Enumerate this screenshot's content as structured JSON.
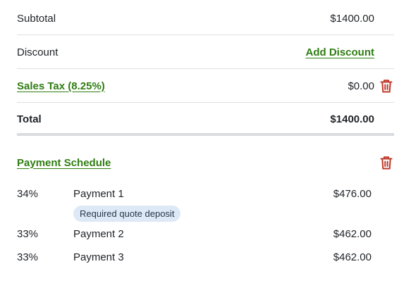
{
  "summary": {
    "subtotal_label": "Subtotal",
    "subtotal_value": "$1400.00",
    "discount_label": "Discount",
    "add_discount_label": "Add Discount",
    "sales_tax_label": "Sales Tax (8.25%)",
    "sales_tax_value": "$0.00",
    "total_label": "Total",
    "total_value": "$1400.00"
  },
  "payment_schedule": {
    "title": "Payment Schedule",
    "payments": [
      {
        "percent": "34%",
        "name": "Payment 1",
        "amount": "$476.00",
        "badge": "Required quote deposit"
      },
      {
        "percent": "33%",
        "name": "Payment 2",
        "amount": "$462.00"
      },
      {
        "percent": "33%",
        "name": "Payment 3",
        "amount": "$462.00"
      }
    ]
  },
  "colors": {
    "link_green": "#2f7d12",
    "trash_red": "#c0392b",
    "badge_bg": "#dde9f6"
  },
  "icons": {
    "delete": "trash-icon"
  }
}
